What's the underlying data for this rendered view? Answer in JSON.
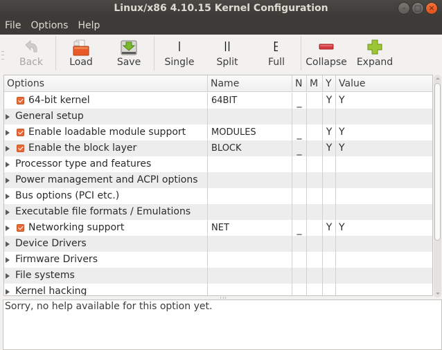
{
  "window": {
    "title": "Linux/x86 4.10.15 Kernel Configuration",
    "controls": [
      "minimize",
      "maximize",
      "close"
    ]
  },
  "menubar": {
    "items": [
      "File",
      "Options",
      "Help"
    ]
  },
  "toolbar": {
    "buttons": [
      {
        "id": "back",
        "label": "Back",
        "icon": "undo-arrow-icon",
        "enabled": false
      },
      {
        "id": "load",
        "label": "Load",
        "icon": "folder-open-icon",
        "enabled": true
      },
      {
        "id": "save",
        "label": "Save",
        "icon": "drive-save-icon",
        "enabled": true
      },
      {
        "id": "single",
        "label": "Single",
        "icon": "single-view-icon",
        "enabled": true
      },
      {
        "id": "split",
        "label": "Split",
        "icon": "split-view-icon",
        "enabled": true
      },
      {
        "id": "full",
        "label": "Full",
        "icon": "full-view-icon",
        "enabled": true
      },
      {
        "id": "collapse",
        "label": "Collapse",
        "icon": "minus-icon",
        "enabled": true
      },
      {
        "id": "expand",
        "label": "Expand",
        "icon": "plus-icon",
        "enabled": true
      }
    ]
  },
  "tree": {
    "columns": [
      "Options",
      "Name",
      "N",
      "M",
      "Y",
      "Value"
    ],
    "rows": [
      {
        "option": "64-bit kernel",
        "expandable": false,
        "checked": true,
        "name": "64BIT",
        "n": "_",
        "m": "",
        "y": "Y",
        "value": "Y"
      },
      {
        "option": "General setup",
        "expandable": true,
        "checked": null,
        "name": "",
        "n": "",
        "m": "",
        "y": "",
        "value": ""
      },
      {
        "option": "Enable loadable module support",
        "expandable": true,
        "checked": true,
        "name": "MODULES",
        "n": "_",
        "m": "",
        "y": "Y",
        "value": "Y"
      },
      {
        "option": "Enable the block layer",
        "expandable": true,
        "checked": true,
        "name": "BLOCK",
        "n": "_",
        "m": "",
        "y": "Y",
        "value": "Y"
      },
      {
        "option": "Processor type and features",
        "expandable": true,
        "checked": null,
        "name": "",
        "n": "",
        "m": "",
        "y": "",
        "value": ""
      },
      {
        "option": "Power management and ACPI options",
        "expandable": true,
        "checked": null,
        "name": "",
        "n": "",
        "m": "",
        "y": "",
        "value": ""
      },
      {
        "option": "Bus options (PCI etc.)",
        "expandable": true,
        "checked": null,
        "name": "",
        "n": "",
        "m": "",
        "y": "",
        "value": ""
      },
      {
        "option": "Executable file formats / Emulations",
        "expandable": true,
        "checked": null,
        "name": "",
        "n": "",
        "m": "",
        "y": "",
        "value": ""
      },
      {
        "option": "Networking support",
        "expandable": true,
        "checked": true,
        "name": "NET",
        "n": "_",
        "m": "",
        "y": "Y",
        "value": "Y"
      },
      {
        "option": "Device Drivers",
        "expandable": true,
        "checked": null,
        "name": "",
        "n": "",
        "m": "",
        "y": "",
        "value": ""
      },
      {
        "option": "Firmware Drivers",
        "expandable": true,
        "checked": null,
        "name": "",
        "n": "",
        "m": "",
        "y": "",
        "value": ""
      },
      {
        "option": "File systems",
        "expandable": true,
        "checked": null,
        "name": "",
        "n": "",
        "m": "",
        "y": "",
        "value": ""
      },
      {
        "option": "Kernel hacking",
        "expandable": true,
        "checked": null,
        "name": "",
        "n": "",
        "m": "",
        "y": "",
        "value": ""
      }
    ]
  },
  "help": {
    "text": "Sorry, no help available for this option yet."
  }
}
